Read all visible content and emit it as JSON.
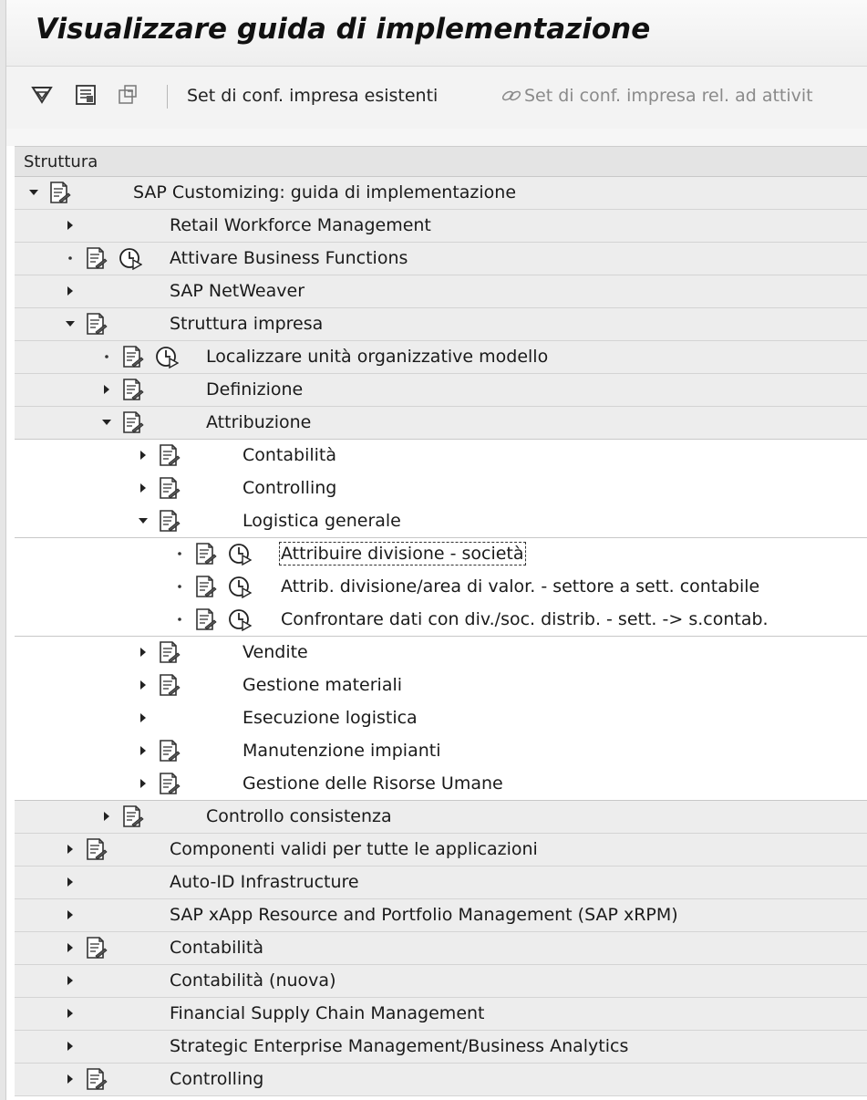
{
  "title": "Visualizzare guida di implementazione",
  "toolbar": {
    "btn_existing": "Set di conf. impresa esistenti",
    "btn_related": "Set di conf. impresa rel. ad attivit"
  },
  "tree": {
    "header": "Struttura",
    "items": [
      {
        "label": "SAP Customizing: guida di implementazione"
      },
      {
        "label": "Retail Workforce Management"
      },
      {
        "label": "Attivare Business Functions"
      },
      {
        "label": "SAP NetWeaver"
      },
      {
        "label": "Struttura impresa"
      },
      {
        "label": "Localizzare unità organizzative modello"
      },
      {
        "label": "Definizione"
      },
      {
        "label": "Attribuzione"
      },
      {
        "label": "Contabilità"
      },
      {
        "label": "Controlling"
      },
      {
        "label": "Logistica generale"
      },
      {
        "label": "Attribuire divisione - società"
      },
      {
        "label": "Attrib. divisione/area di valor. - settore a sett. contabile"
      },
      {
        "label": "Confrontare dati con div./soc. distrib. - sett. -> s.contab."
      },
      {
        "label": "Vendite"
      },
      {
        "label": "Gestione materiali"
      },
      {
        "label": "Esecuzione logistica"
      },
      {
        "label": "Manutenzione impianti"
      },
      {
        "label": "Gestione delle Risorse Umane"
      },
      {
        "label": "Controllo consistenza"
      },
      {
        "label": "Componenti validi per tutte le applicazioni"
      },
      {
        "label": "Auto-ID Infrastructure"
      },
      {
        "label": "SAP xApp Resource and Portfolio Management (SAP xRPM)"
      },
      {
        "label": "Contabilità"
      },
      {
        "label": "Contabilità (nuova)"
      },
      {
        "label": "Financial Supply Chain Management"
      },
      {
        "label": "Strategic Enterprise Management/Business Analytics"
      },
      {
        "label": "Controlling"
      }
    ]
  }
}
